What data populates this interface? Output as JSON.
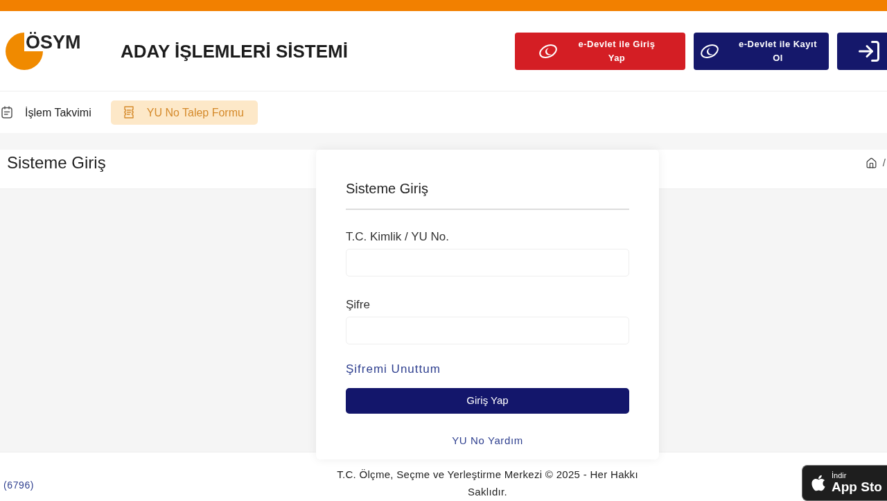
{
  "header": {
    "logo": {
      "text": "ÖSYM"
    },
    "title": "ADAY İŞLEMLERİ SİSTEMİ",
    "buttons": [
      {
        "kind": "edevlet",
        "label": "e-Devlet ile Giriş Yap",
        "color": "#d41e24"
      },
      {
        "kind": "edevlet",
        "label": "e-Devlet ile Kayıt Ol",
        "color": "#15186b"
      },
      {
        "kind": "login",
        "color": "#15186b"
      }
    ]
  },
  "nav": {
    "items": [
      {
        "label": "İşlem Takvimi",
        "selected": false
      },
      {
        "label": "YU No Talep Formu",
        "selected": true
      }
    ]
  },
  "page_header": {
    "title": "Sisteme Giriş",
    "breadcrumb_separator": "/"
  },
  "login_form": {
    "title": "Sisteme Giriş",
    "fields": [
      {
        "label": "T.C. Kimlik / YU No."
      },
      {
        "label": "Şifre"
      }
    ],
    "forgot_link": "Şifremi Unuttum",
    "submit": "Giriş Yap",
    "help_link": "YU No Yardım"
  },
  "footer": {
    "counter": "(6796)",
    "copyright": "T.C. Ölçme, Seçme ve Yerleştirme Merkezi © 2025 - Her Hakkı Saklıdır.",
    "app_store_badge": {
      "small_text": "İndir",
      "big_text": "App Sto"
    }
  }
}
